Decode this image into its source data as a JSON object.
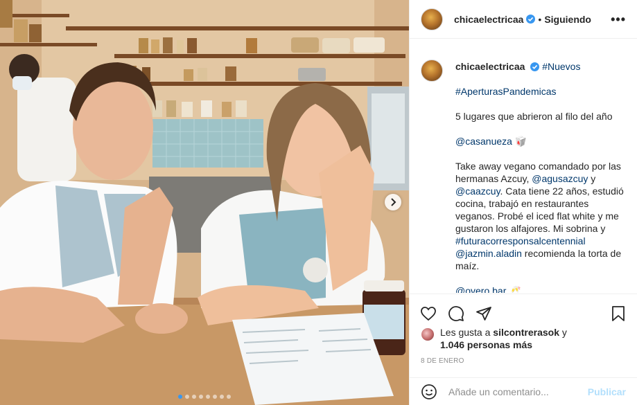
{
  "post": {
    "username": "chicaelectricaa",
    "follow_status": "Siguiendo",
    "more_label": "•••",
    "separator": "•"
  },
  "caption": {
    "username": "chicaelectricaa",
    "lines": {
      "tag1": "#Nuevos",
      "tag2": "#AperturasPandemicas",
      "intro": "5 lugares que abrieron al filo del año",
      "mention1": "@casanueza",
      "mention1_suffix": " 🥡",
      "p1_a": "Take away vegano comandado por las hermanas Azcuy, ",
      "p1_m1": "@agusazcuy",
      "p1_b": " y ",
      "p1_m2": "@caazcuy",
      "p1_c": ". Cata tiene 22 años, estudió cocina, trabajó en restaurantes veganos. Probé el iced flat white y me gustaron los alfajores. Mi sobrina y ",
      "p1_tag": "#futuracorresponsalcentennial",
      "p1_d": " ",
      "p1_m3": "@jazmin.aladin",
      "p1_e": " recomienda la torta de maíz.",
      "mention2": "@overo.bar",
      "mention2_suffix": " 🥂"
    }
  },
  "likes": {
    "prefix": "Les gusta a ",
    "user": "silcontrerasok",
    "middle": " y",
    "count": "1.046 personas más"
  },
  "date": "8 de enero",
  "comment": {
    "placeholder": "Añade un comentario...",
    "publish_label": "Publicar"
  },
  "carousel": {
    "total": 8,
    "active": 0
  },
  "icons": [
    "heart-icon",
    "comment-icon",
    "share-icon",
    "bookmark-icon",
    "emoji-icon",
    "verified-icon",
    "chevron-right-icon"
  ],
  "colors": {
    "accent": "#3897f0",
    "link": "#00376b",
    "publish_disabled": "#b2dffc",
    "muted": "#8e8e8e"
  }
}
